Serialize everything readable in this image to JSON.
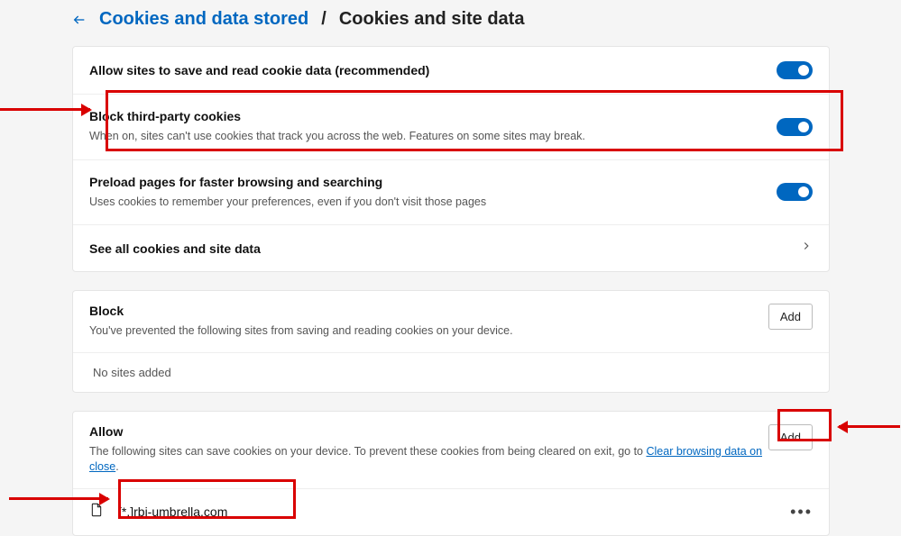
{
  "breadcrumb": {
    "link": "Cookies and data stored",
    "separator": "/",
    "current": "Cookies and site data"
  },
  "settings": {
    "allow_save": {
      "title": "Allow sites to save and read cookie data (recommended)"
    },
    "block_third": {
      "title": "Block third-party cookies",
      "desc": "When on, sites can't use cookies that track you across the web. Features on some sites may break."
    },
    "preload": {
      "title": "Preload pages for faster browsing and searching",
      "desc": "Uses cookies to remember your preferences, even if you don't visit those pages"
    },
    "see_all": {
      "title": "See all cookies and site data"
    }
  },
  "block_section": {
    "title": "Block",
    "desc": "You've prevented the following sites from saving and reading cookies on your device.",
    "add_label": "Add",
    "empty": "No sites added"
  },
  "allow_section": {
    "title": "Allow",
    "desc_before": "The following sites can save cookies on your device. To prevent these cookies from being cleared on exit, go to ",
    "link_text": "Clear browsing data on close",
    "desc_after": ".",
    "add_label": "Add",
    "items": [
      {
        "label": "[*.]rbi-umbrella.com"
      }
    ]
  }
}
